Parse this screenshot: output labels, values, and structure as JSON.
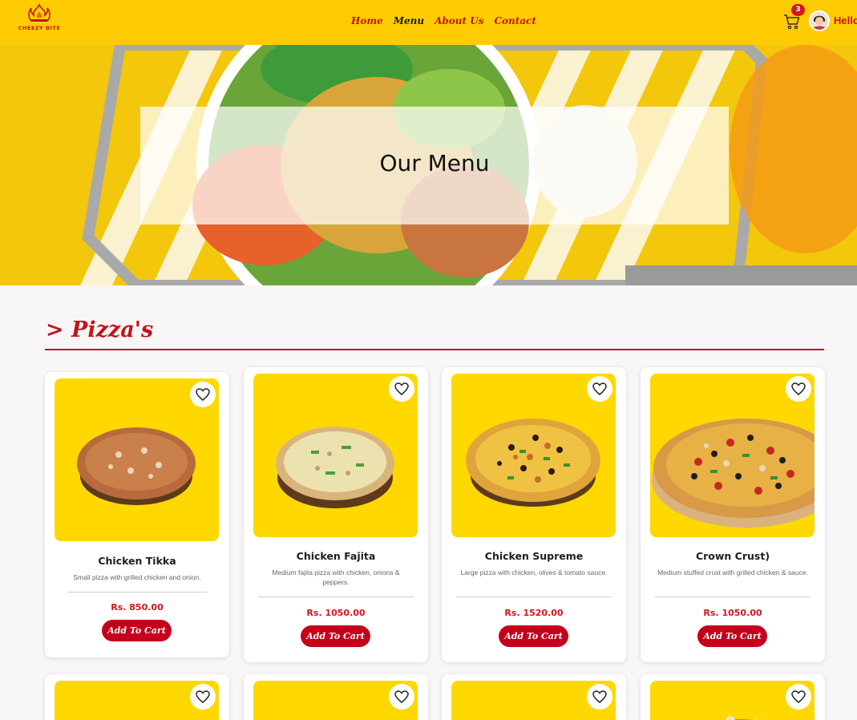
{
  "brand": {
    "name": "CHEEZY BITE",
    "logo_icon": "flame-icon"
  },
  "nav": {
    "items": [
      {
        "label": "Home",
        "active": false
      },
      {
        "label": "Menu",
        "active": true
      },
      {
        "label": "About Us",
        "active": false
      },
      {
        "label": "Contact",
        "active": false
      }
    ]
  },
  "header": {
    "cart_count": "3",
    "greeting": "Hello"
  },
  "hero": {
    "title": "Our Menu"
  },
  "section": {
    "title": "> Pizza's"
  },
  "colors": {
    "accent": "#c0151b",
    "nav_bg": "#ffcc04",
    "card_img_bg": "#ffd800",
    "button": "#c4001b"
  },
  "products": [
    {
      "name": "Chicken Tikka",
      "desc": "Small pizza with grilled chicken and onion.",
      "price": "Rs. 850.00",
      "button": "Add To Cart"
    },
    {
      "name": "Chicken Fajita",
      "desc": "Medium fajita pizza with chicken, onions & peppers.",
      "price": "Rs. 1050.00",
      "button": "Add To Cart"
    },
    {
      "name": "Chicken Supreme",
      "desc": "Large pizza with chicken, olives & tomato sauce.",
      "price": "Rs. 1520.00",
      "button": "Add To Cart"
    },
    {
      "name": "Crown Crust)",
      "desc": "Medium stuffed crust with grilled chicken & sauce.",
      "price": "Rs. 1050.00",
      "button": "Add To Cart"
    }
  ]
}
